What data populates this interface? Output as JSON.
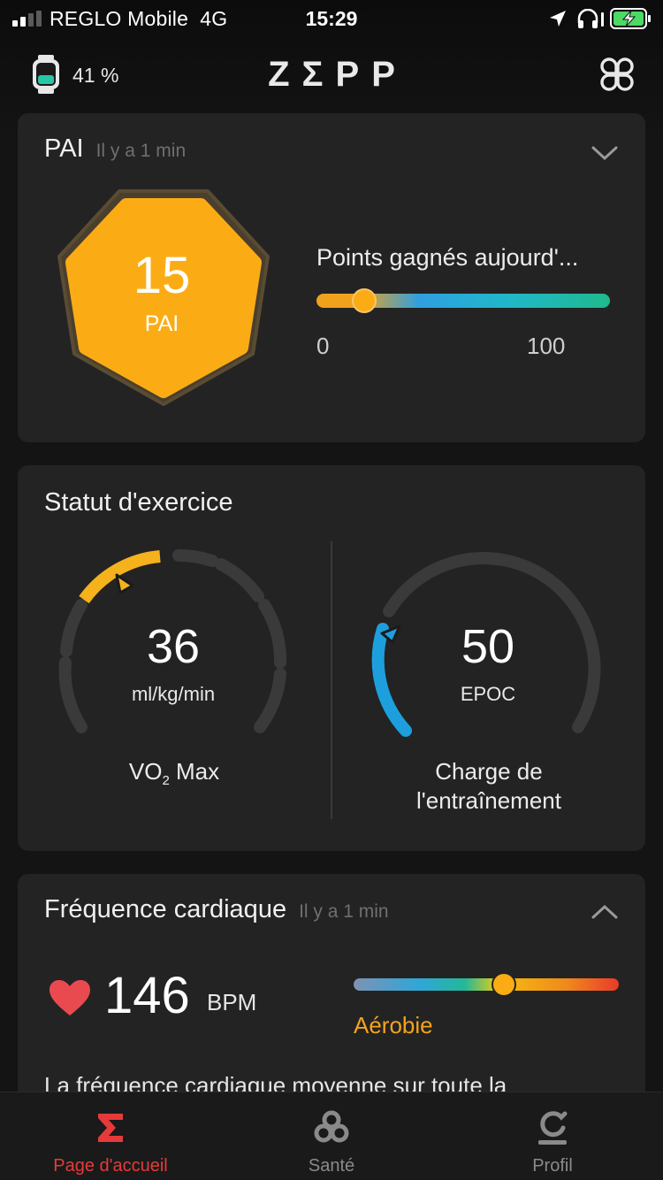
{
  "status_bar": {
    "carrier": "REGLO Mobile",
    "network": "4G",
    "time": "15:29"
  },
  "header": {
    "watch_battery": "41 %",
    "logo": "ZΣPP",
    "watch_icon": "watch-icon",
    "menu_icon": "grid-menu-icon"
  },
  "pai": {
    "title": "PAI",
    "updated": "Il y a 1 min",
    "value": "15",
    "unit": "PAI",
    "points_label": "Points gagnés aujourd'...",
    "range_min": "0",
    "range_max": "100",
    "points_today_fraction": 0.17,
    "accent": "#FBAC15"
  },
  "exercise": {
    "title": "Statut d'exercice",
    "vo2": {
      "value": "36",
      "unit": "ml/kg/min",
      "label_prefix": "VO",
      "label_sub": "2",
      "label_suffix": " Max",
      "color": "#F5B21C"
    },
    "epoc": {
      "value": "50",
      "unit": "EPOC",
      "label_line1": "Charge de",
      "label_line2": "l'entraînement",
      "color": "#1E9FDD"
    }
  },
  "heart_rate": {
    "title": "Fréquence cardiaque",
    "updated": "Il y a 1 min",
    "value": "146",
    "unit": "BPM",
    "zone": "Aérobie",
    "zone_position_fraction": 0.57,
    "description": "La fréquence cardiaque moyenne sur toute la",
    "heart_color": "#E84A4F"
  },
  "tabs": [
    {
      "label": "Page d'accueil",
      "icon": "sigma-icon",
      "active": true
    },
    {
      "label": "Santé",
      "icon": "health-icon",
      "active": false
    },
    {
      "label": "Profil",
      "icon": "profile-icon",
      "active": false
    }
  ]
}
